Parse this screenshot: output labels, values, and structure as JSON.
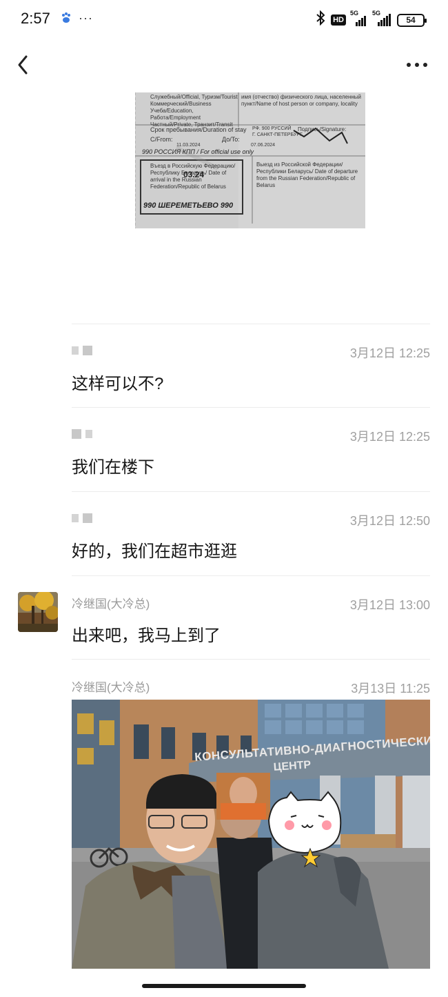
{
  "status_bar": {
    "time": "2:57",
    "more": "···",
    "hd_label": "HD",
    "signal1_label": "5G",
    "signal2_label": "5G",
    "battery": "54"
  },
  "nav": {
    "back_icon": "chevron-left-icon",
    "more_icon": "more-dots-icon"
  },
  "document": {
    "lines_left": [
      "Служебный/Official, Туризм/Tourist",
      "Коммерческий/Business",
      "Учеба/Education, Работа/Employment",
      "Частный/Private, Транзит/Transit"
    ],
    "lines_right": [
      "имя (отчество) физического лица, населенный",
      "пункт/Name of host person or company, locality"
    ],
    "stay_label": "Срок пребывания/Duration of stay",
    "from_label": "С/From:",
    "to_label": "До/To:",
    "signature_label": "Подпись/Signature:",
    "city_stamp": "Г. САНКТ-ПЕТЕРБУРГ",
    "city_stamp2": "РФ. 900 РУССИЙ",
    "official_label": "990 РОССИЯ КПП / For official use only",
    "date_from": "11.03.2024",
    "date_to": "07.06.2024",
    "entry_label": "Въезд в Российскую Федерацию/ Республику Беларусь/ Date of arrival in the Russian Federation/Republic of Belarus",
    "exit_label": "Выезд из Российской Федерации/ Республики Беларусь/ Date of departure from the Russian Federation/Republic of Belarus",
    "stamp_date": "03.24",
    "stamp_airport": "990 ШЕРЕМЕТЬЕВО 990"
  },
  "messages": [
    {
      "sender": "",
      "time": "3月12日 12:25",
      "text": "这样可以不?"
    },
    {
      "sender": "",
      "time": "3月12日 12:25",
      "text": "我们在楼下"
    },
    {
      "sender": "",
      "time": "3月12日 12:50",
      "text": "好的，我们在超市逛逛"
    },
    {
      "sender": "冷继国(大冷总)",
      "time": "3月12日 13:00",
      "text": "出来吧，我马上到了"
    },
    {
      "sender": "冷继国(大冷总)",
      "time": "3月13日 11:25",
      "text": ""
    }
  ],
  "photo": {
    "building_sign_line1": "КОНСУЛЬТАТИВНО-ДИАГНОСТИЧЕСКИЙ",
    "building_sign_line2": "ЦЕНТР"
  },
  "colors": {
    "time_gray": "#a0a0a0",
    "sender_gray": "#9a9a9a",
    "divider": "#ececec",
    "text": "#161616"
  }
}
